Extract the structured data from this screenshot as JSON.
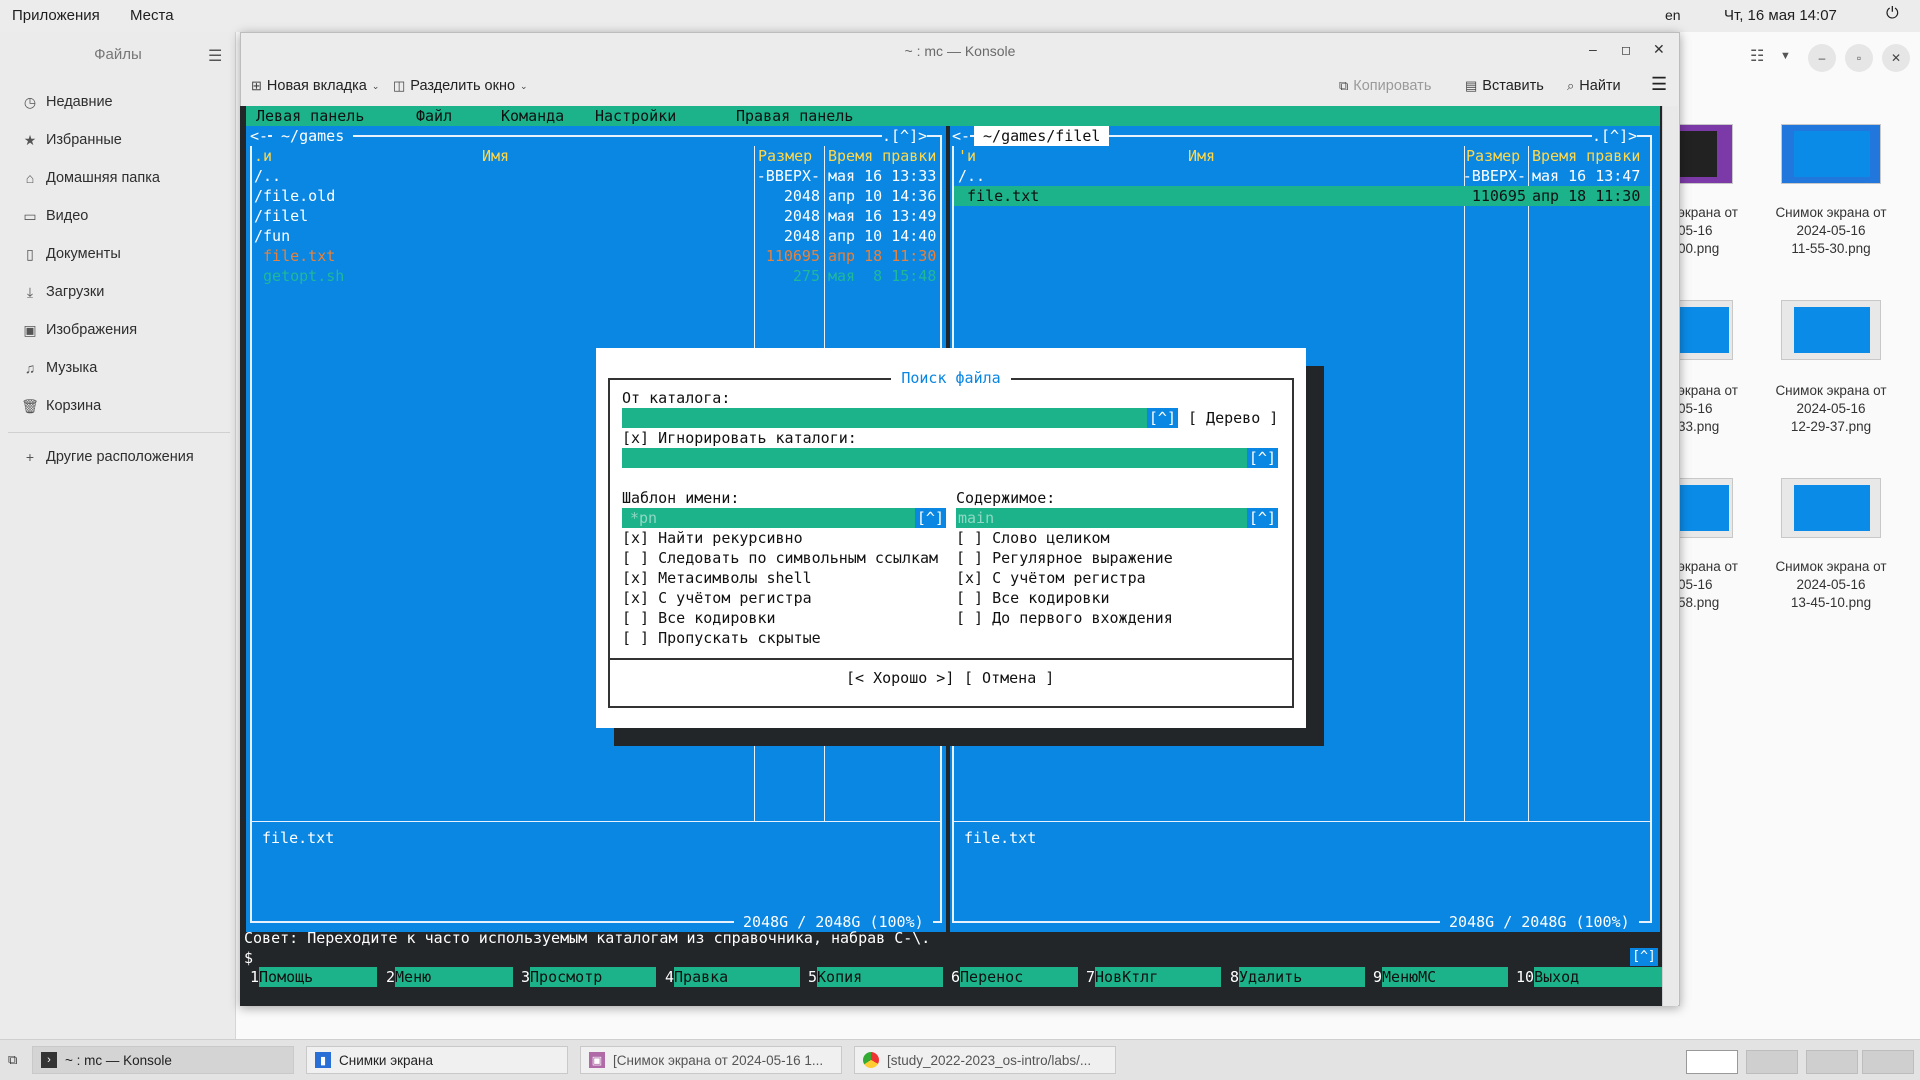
{
  "topbar": {
    "apps": "Приложения",
    "places": "Места",
    "lang": "en",
    "clock": "Чт, 16 мая  14:07"
  },
  "files_app": {
    "title": "Файлы",
    "sidebar": [
      "Недавние",
      "Избранные",
      "Домашняя папка",
      "Видео",
      "Документы",
      "Загрузки",
      "Изображения",
      "Музыка",
      "Корзина"
    ],
    "other_locations": "Другие расположения",
    "captions": [
      [
        "экрана от",
        "05-16",
        "00.png"
      ],
      [
        "Снимок экрана от",
        "2024-05-16",
        "11-55-30.png"
      ],
      [
        "экрана от",
        "05-16",
        "33.png"
      ],
      [
        "Снимок экрана от",
        "2024-05-16",
        "12-29-37.png"
      ],
      [
        "экрана от",
        "05-16",
        "58.png"
      ],
      [
        "Снимок экрана от",
        "2024-05-16",
        "13-45-10.png"
      ]
    ]
  },
  "konsole": {
    "title": "~ : mc — Konsole",
    "toolbar": {
      "new_tab": "Новая вкладка",
      "split": "Разделить окно",
      "copy": "Копировать",
      "paste": "Вставить",
      "find": "Найти"
    }
  },
  "mc": {
    "menubar": [
      "Левая панель",
      "Файл",
      "Команда",
      "Настройки",
      "Правая панель"
    ],
    "left": {
      "path": " ~/games ",
      "header": {
        "n": ".и",
        "name": "Имя",
        "size": "Размер",
        "time": "Время правки"
      },
      "rows": [
        {
          "name": "/..",
          "size": "-ВВЕРХ-",
          "time": "мая 16 13:33",
          "style": "dir"
        },
        {
          "name": "/file.old",
          "size": "2048",
          "time": "апр 10 14:36",
          "style": "dir"
        },
        {
          "name": "/filel",
          "size": "2048",
          "time": "мая 16 13:49",
          "style": "dir"
        },
        {
          "name": "/fun",
          "size": "2048",
          "time": "апр 10 14:40",
          "style": "dir"
        },
        {
          "name": " file.txt",
          "size": "110695",
          "time": "апр 18 11:30",
          "style": "file"
        },
        {
          "name": " getopt.sh",
          "size": "275",
          "time": "мая  8 15:48",
          "style": "exec"
        }
      ],
      "status": "file.txt",
      "disk": " 2048G / 2048G (100%) "
    },
    "right": {
      "path": " ~/games/filel ",
      "header": {
        "n": "'и",
        "name": "Имя",
        "size": "Размер",
        "time": "Время правки"
      },
      "rows": [
        {
          "name": "/..",
          "size": "-ВВЕРХ-",
          "time": "мая 16 13:47",
          "style": "dir"
        },
        {
          "name": " file.txt",
          "size": "110695",
          "time": "апр 18 11:30",
          "style": "selected"
        }
      ],
      "status": "file.txt",
      "disk": " 2048G / 2048G (100%) "
    },
    "hint": "Совет: Переходите к часто используемым каталогам из справочника, набрав C-\\.",
    "prompt": "$",
    "prompt_badge": "[^]",
    "fkeys": [
      {
        "n": "1",
        "label": "Помощь"
      },
      {
        "n": "2",
        "label": "Меню"
      },
      {
        "n": "3",
        "label": "Просмотр"
      },
      {
        "n": "4",
        "label": "Правка"
      },
      {
        "n": "5",
        "label": "Копия"
      },
      {
        "n": "6",
        "label": "Перенос"
      },
      {
        "n": "7",
        "label": "НовКтлг"
      },
      {
        "n": "8",
        "label": "Удалить"
      },
      {
        "n": "9",
        "label": "МенюMC"
      },
      {
        "n": "10",
        "label": "Выход"
      }
    ],
    "dialog": {
      "title": "Поиск файла",
      "from_dir_label": "От каталога:",
      "tree_button": "[ Дерево ]",
      "ignore_dirs": "[x] Игнорировать каталоги:",
      "name_pattern_label": "Шаблон имени:",
      "name_pattern_value": "*pn",
      "content_label": "Содержимое:",
      "content_value": "main",
      "left_opts": [
        "[x] Найти рекурсивно",
        "[ ] Следовать по символьным ссылкам",
        "[x] Метасимволы shell",
        "[x] С учётом регистра",
        "[ ] Все кодировки",
        "[ ] Пропускать скрытые"
      ],
      "right_opts": [
        "[ ] Слово целиком",
        "[ ] Регулярное выражение",
        "[x] С учётом регистра",
        "[ ] Все кодировки",
        "[ ] До первого вхождения"
      ],
      "ok": "[< Хорошо >]",
      "cancel": "[ Отмена ]",
      "input_btn": "[^]"
    }
  },
  "taskbar": {
    "tasks": [
      "~ : mc — Konsole",
      "Снимки экрана",
      "[Снимок экрана от 2024-05-16 1...",
      "[study_2022-2023_os-intro/labs/..."
    ]
  }
}
